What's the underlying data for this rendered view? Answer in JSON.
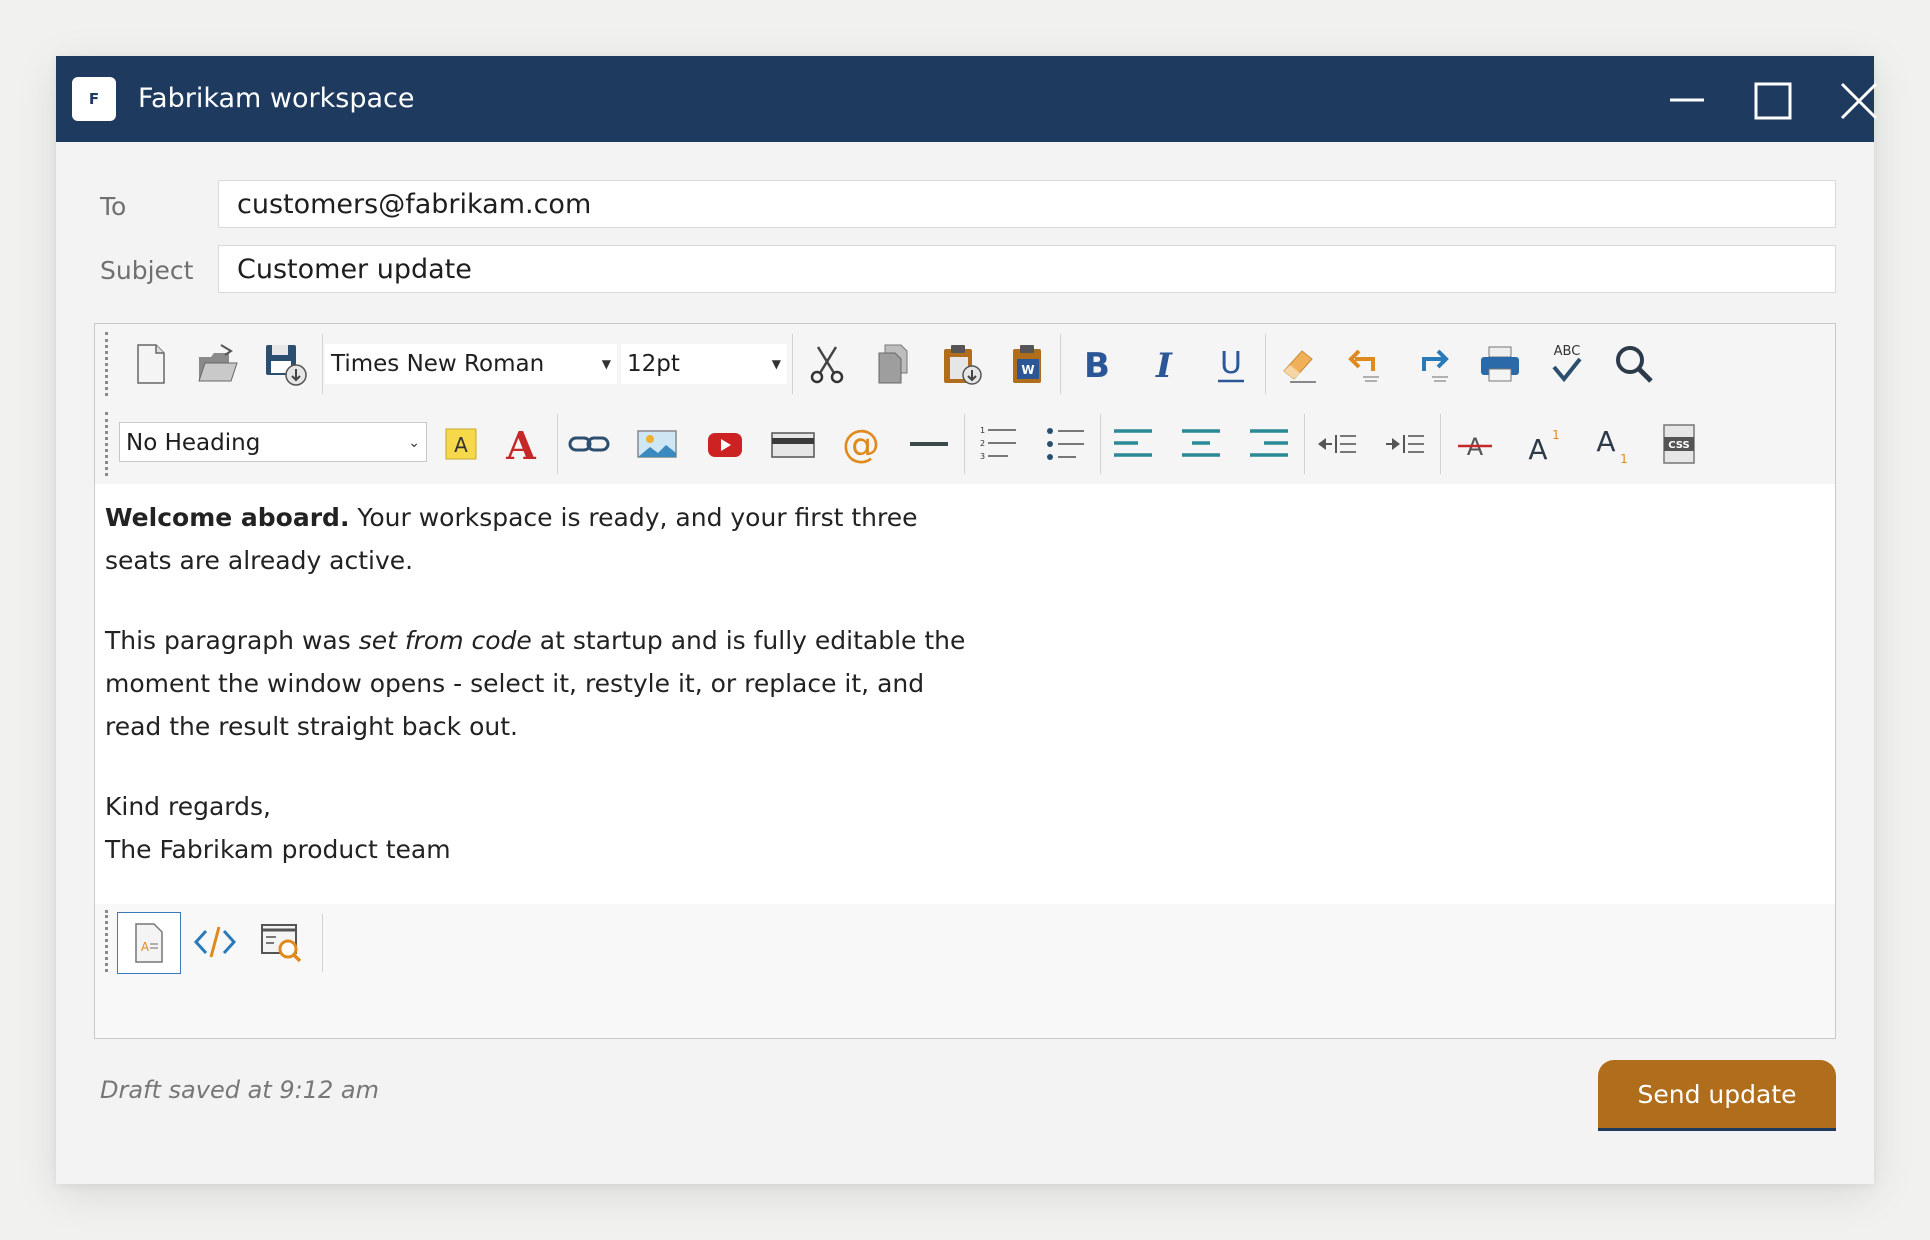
{
  "window": {
    "logo_letter": "F",
    "title": "Fabrikam workspace"
  },
  "form": {
    "to_label": "To",
    "to_value": "customers@fabrikam.com",
    "subject_label": "Subject",
    "subject_value": "Customer update"
  },
  "toolbar": {
    "font_family": "Times New Roman",
    "font_size": "12pt",
    "heading": "No Heading",
    "highlight_letter": "A",
    "font_color_letter": "A",
    "superscript_letter": "A",
    "superscript_mark": "1",
    "subscript_letter": "A",
    "subscript_mark": "1",
    "spellcheck_letters": "ABC",
    "css_label": "CSS",
    "word_badge": "W",
    "at_symbol": "@",
    "icons": [
      "new-document-icon",
      "open-folder-icon",
      "save-icon",
      "cut-icon",
      "copy-icon",
      "paste-icon",
      "paste-from-word-icon",
      "bold-icon",
      "italic-icon",
      "underline-icon",
      "eraser-icon",
      "undo-icon",
      "redo-icon",
      "print-icon",
      "spellcheck-icon",
      "find-icon",
      "highlight-color-icon",
      "font-color-icon",
      "link-icon",
      "image-icon",
      "video-icon",
      "table-icon",
      "at-symbol-icon",
      "horizontal-rule-icon",
      "numbered-list-icon",
      "bulleted-list-icon",
      "align-left-icon",
      "align-center-icon",
      "align-right-icon",
      "outdent-icon",
      "indent-icon",
      "strikethrough-icon",
      "superscript-icon",
      "subscript-icon",
      "css-icon",
      "design-view-icon",
      "code-view-icon",
      "preview-icon"
    ]
  },
  "content": {
    "p1_bold": "Welcome aboard.",
    "p1_line1": " Your workspace is ready, and your first three",
    "p1_line2": "seats are already active.",
    "p2_before": "This paragraph was ",
    "p2_italic": "set from code",
    "p2_line1_after": " at startup and is fully editable the",
    "p2_line2": "moment the window opens - select it, restyle it, or replace it, and",
    "p2_line3": "read the result straight back out.",
    "p3_line1": "Kind regards,",
    "p3_line2": "The Fabrikam product team"
  },
  "footer": {
    "status": "Draft saved at 9:12 am",
    "send_label": "Send update"
  },
  "colors": {
    "titlebar": "#1f3a5f",
    "accent": "#b06e1d",
    "teal": "#2a8a95",
    "red": "#c62828"
  }
}
